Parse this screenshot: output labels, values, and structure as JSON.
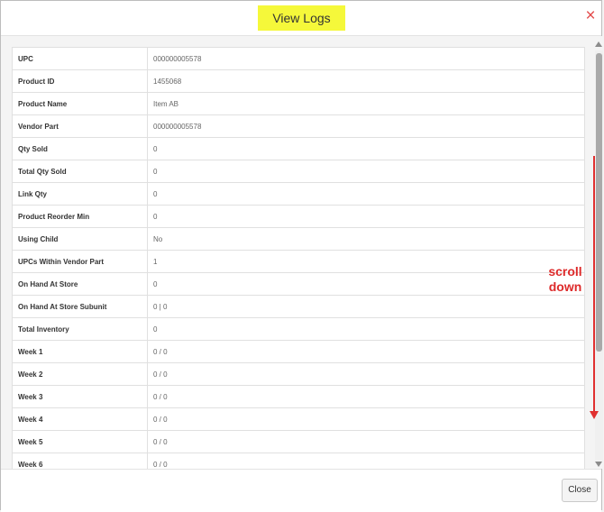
{
  "modal": {
    "title": "View Logs",
    "close_icon": "×"
  },
  "annotation": {
    "line1": "scroll",
    "line2": "down",
    "color": "#e03030"
  },
  "rows": [
    {
      "label": "UPC",
      "value": "000000005578"
    },
    {
      "label": "Product ID",
      "value": "1455068"
    },
    {
      "label": "Product Name",
      "value": "Item AB"
    },
    {
      "label": "Vendor Part",
      "value": "000000005578"
    },
    {
      "label": "Qty Sold",
      "value": "0"
    },
    {
      "label": "Total Qty Sold",
      "value": "0"
    },
    {
      "label": "Link Qty",
      "value": "0"
    },
    {
      "label": "Product Reorder Min",
      "value": "0"
    },
    {
      "label": "Using Child",
      "value": "No"
    },
    {
      "label": "UPCs Within Vendor Part",
      "value": "1"
    },
    {
      "label": "On Hand At Store",
      "value": "0"
    },
    {
      "label": "On Hand At Store Subunit",
      "value": "0 | 0"
    },
    {
      "label": "Total Inventory",
      "value": "0"
    },
    {
      "label": "Week 1",
      "value": "0 / 0"
    },
    {
      "label": "Week 2",
      "value": "0 / 0"
    },
    {
      "label": "Week 3",
      "value": "0 / 0"
    },
    {
      "label": "Week 4",
      "value": "0 / 0"
    },
    {
      "label": "Week 5",
      "value": "0 / 0"
    },
    {
      "label": "Week 6",
      "value": "0 / 0"
    }
  ],
  "footer": {
    "close_label": "Close"
  },
  "colors": {
    "title_highlight": "#f5f83a",
    "close_icon": "#e34b4b"
  }
}
